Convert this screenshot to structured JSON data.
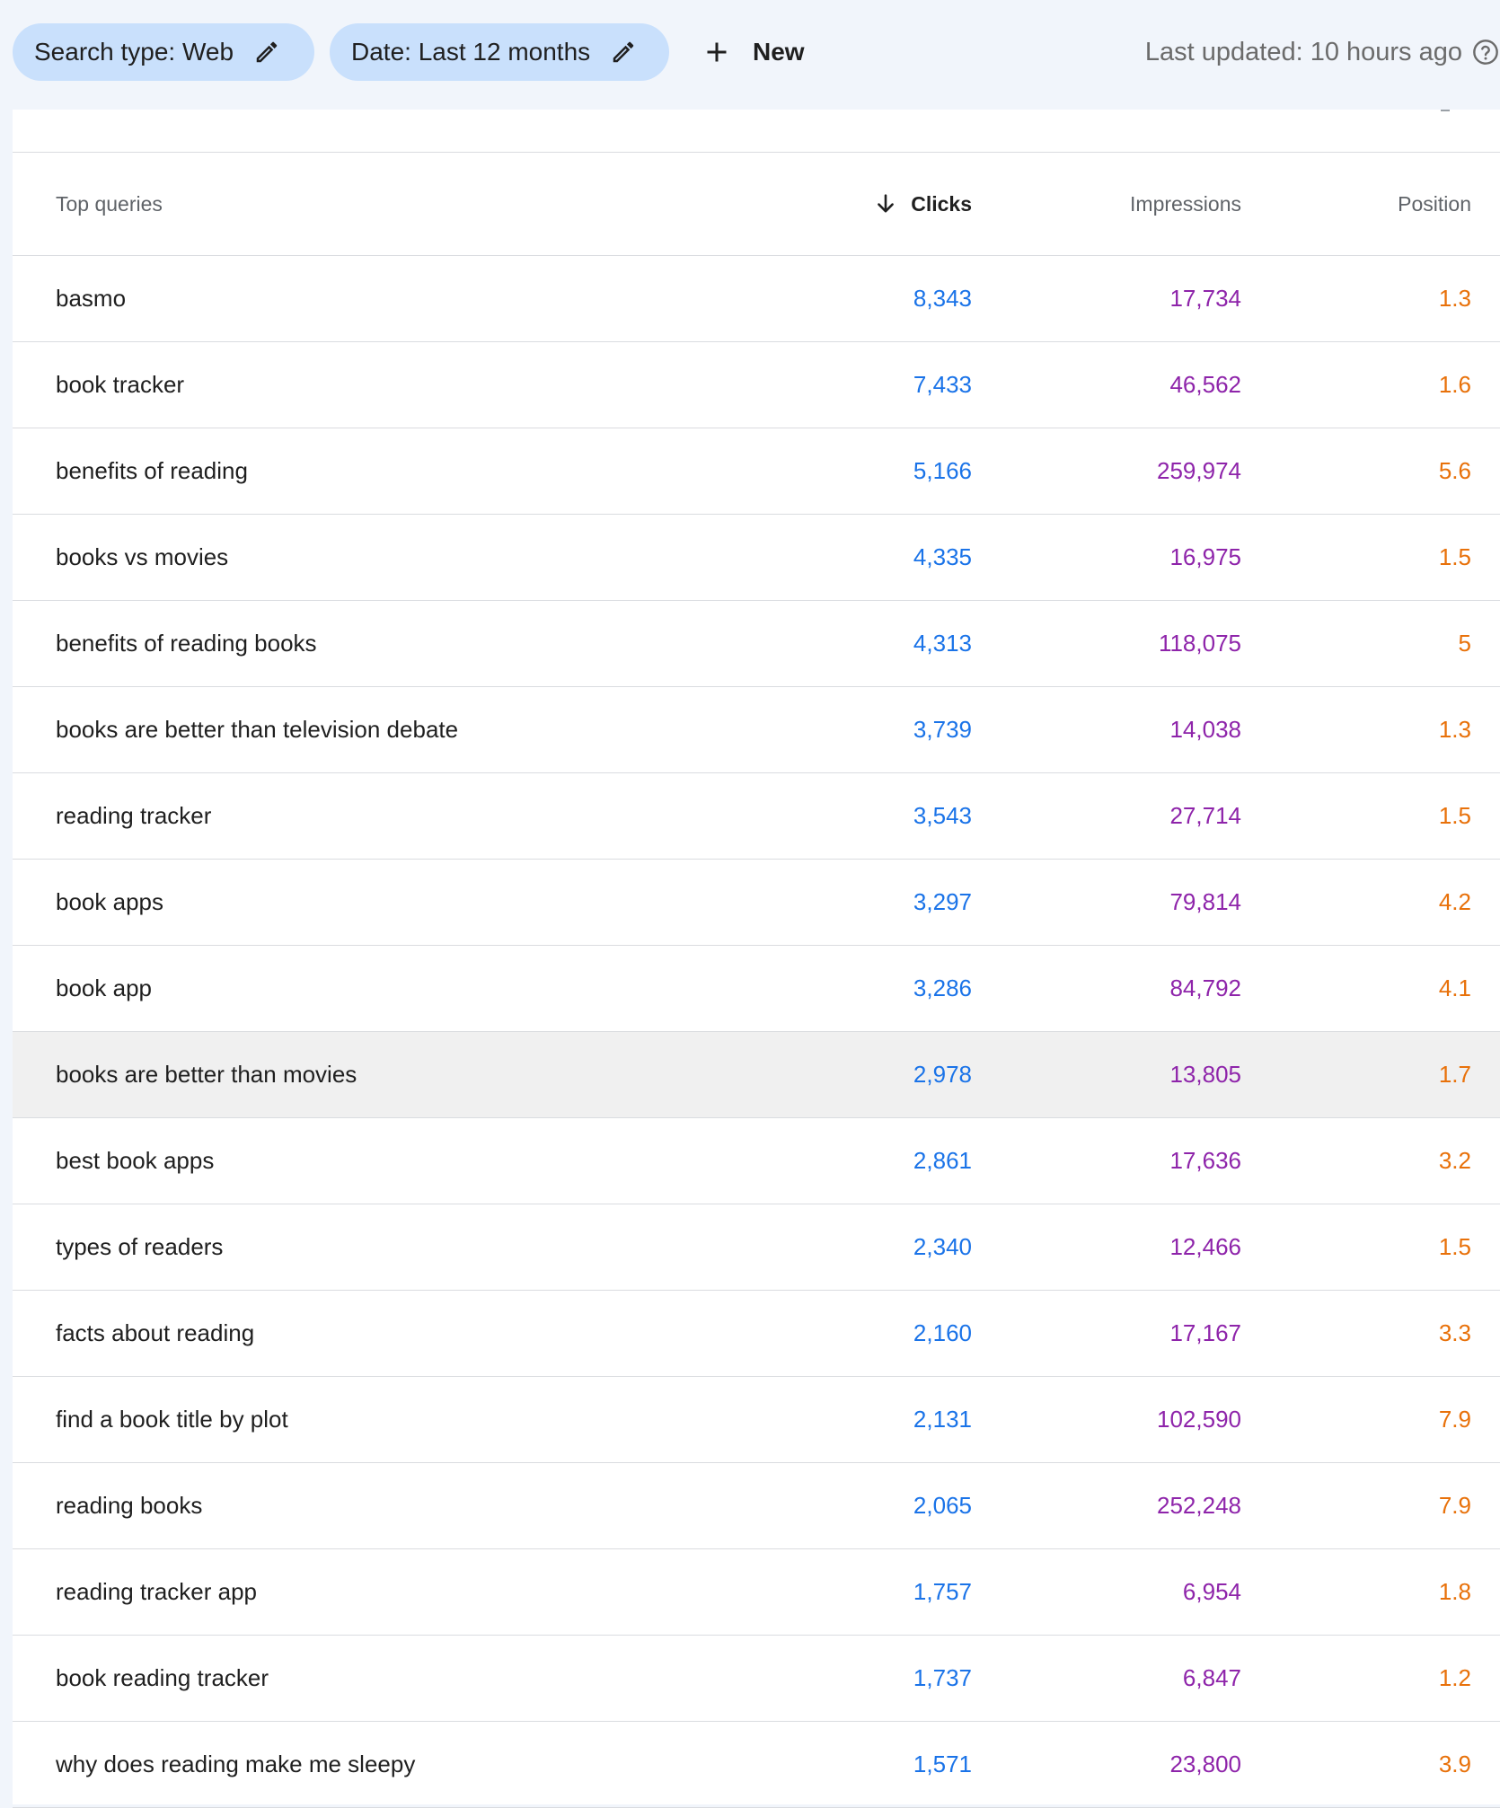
{
  "filters": {
    "search_type": "Search type: Web",
    "date": "Date: Last 12 months",
    "new_label": "New"
  },
  "status": {
    "last_updated": "Last updated: 10 hours ago"
  },
  "table": {
    "headers": {
      "query": "Top queries",
      "clicks": "Clicks",
      "impressions": "Impressions",
      "position": "Position"
    },
    "sort": {
      "column": "clicks",
      "direction": "descending"
    },
    "highlighted_row": 9,
    "rows": [
      {
        "query": "basmo",
        "clicks": "8,343",
        "impressions": "17,734",
        "position": "1.3"
      },
      {
        "query": "book tracker",
        "clicks": "7,433",
        "impressions": "46,562",
        "position": "1.6"
      },
      {
        "query": "benefits of reading",
        "clicks": "5,166",
        "impressions": "259,974",
        "position": "5.6"
      },
      {
        "query": "books vs movies",
        "clicks": "4,335",
        "impressions": "16,975",
        "position": "1.5"
      },
      {
        "query": "benefits of reading books",
        "clicks": "4,313",
        "impressions": "118,075",
        "position": "5"
      },
      {
        "query": "books are better than television debate",
        "clicks": "3,739",
        "impressions": "14,038",
        "position": "1.3"
      },
      {
        "query": "reading tracker",
        "clicks": "3,543",
        "impressions": "27,714",
        "position": "1.5"
      },
      {
        "query": "book apps",
        "clicks": "3,297",
        "impressions": "79,814",
        "position": "4.2"
      },
      {
        "query": "book app",
        "clicks": "3,286",
        "impressions": "84,792",
        "position": "4.1"
      },
      {
        "query": "books are better than movies",
        "clicks": "2,978",
        "impressions": "13,805",
        "position": "1.7"
      },
      {
        "query": "best book apps",
        "clicks": "2,861",
        "impressions": "17,636",
        "position": "3.2"
      },
      {
        "query": "types of readers",
        "clicks": "2,340",
        "impressions": "12,466",
        "position": "1.5"
      },
      {
        "query": "facts about reading",
        "clicks": "2,160",
        "impressions": "17,167",
        "position": "3.3"
      },
      {
        "query": "find a book title by plot",
        "clicks": "2,131",
        "impressions": "102,590",
        "position": "7.9"
      },
      {
        "query": "reading books",
        "clicks": "2,065",
        "impressions": "252,248",
        "position": "7.9"
      },
      {
        "query": "reading tracker app",
        "clicks": "1,757",
        "impressions": "6,954",
        "position": "1.8"
      },
      {
        "query": "book reading tracker",
        "clicks": "1,737",
        "impressions": "6,847",
        "position": "1.2"
      },
      {
        "query": "why does reading make me sleepy",
        "clicks": "1,571",
        "impressions": "23,800",
        "position": "3.9"
      }
    ]
  },
  "colors": {
    "chip_bg": "#c9e0fc",
    "clicks": "#1a73e8",
    "impressions": "#8e24aa",
    "position": "#e8710a",
    "highlight_row": "#f0f0f0"
  },
  "icons": {
    "edit": "pencil-icon",
    "add": "plus-icon",
    "help": "help-circle-icon",
    "sort": "arrow-down-icon"
  }
}
